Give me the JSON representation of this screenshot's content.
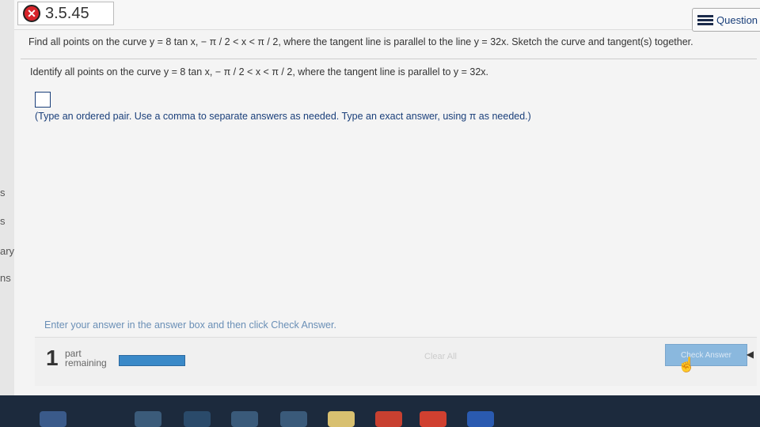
{
  "header": {
    "title": "3.5.45",
    "question_label": "Question"
  },
  "sidebar": {
    "items": [
      "s",
      "s",
      "ary",
      "ns"
    ]
  },
  "problem": {
    "question": "Find all points on the curve y = 8 tan x,  − π / 2 < x < π / 2, where the tangent line is parallel to the line y = 32x. Sketch the curve and tangent(s) together.",
    "identify": "Identify all points on the curve y = 8 tan x,  − π / 2 < x < π / 2, where the tangent line is parallel to y = 32x.",
    "instruction": "(Type an ordered pair. Use a comma to separate answers as needed. Type an exact answer, using π as needed.)"
  },
  "footer": {
    "message": "Enter your answer in the answer box and then click Check Answer.",
    "parts_count": "1",
    "parts_label_1": "part",
    "parts_label_2": "remaining",
    "clear_all": "Clear All",
    "check_answer": "Check Answer"
  },
  "colors": {
    "accent": "#3a89c8",
    "error": "#d8242a"
  }
}
